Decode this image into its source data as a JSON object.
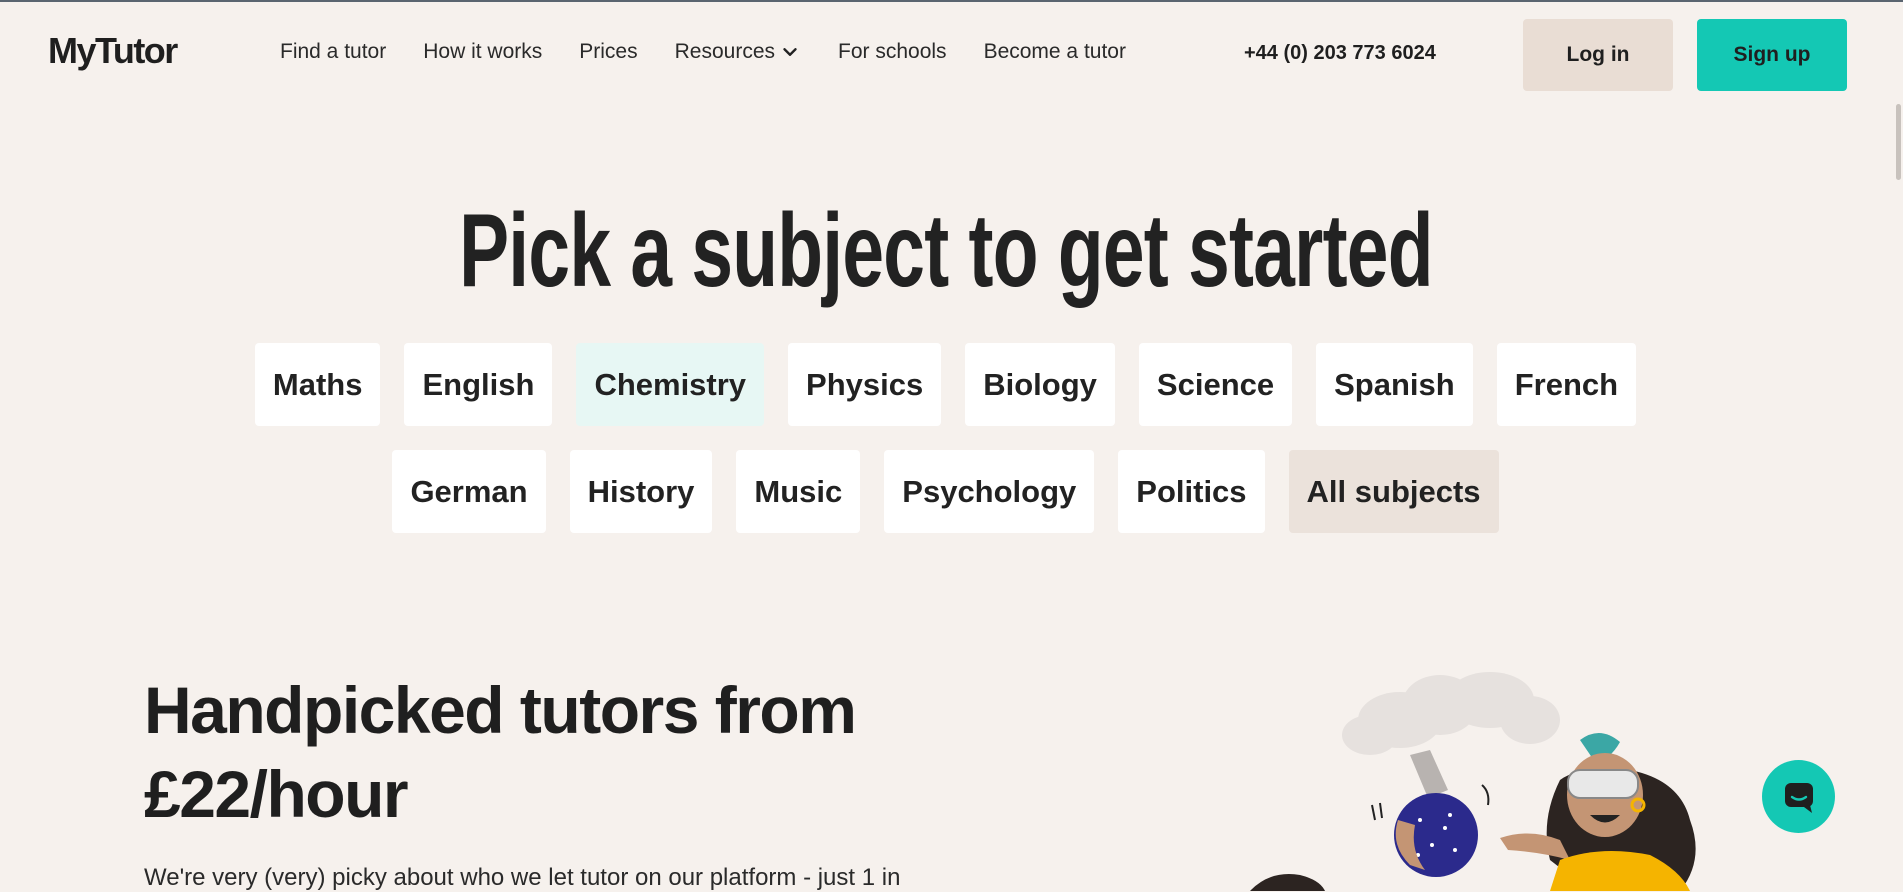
{
  "header": {
    "logo": "MyTutor",
    "nav": [
      {
        "label": "Find a tutor"
      },
      {
        "label": "How it works"
      },
      {
        "label": "Prices"
      },
      {
        "label": "Resources"
      },
      {
        "label": "For schools"
      },
      {
        "label": "Become a tutor"
      }
    ],
    "phone": "+44 (0) 203 773 6024",
    "login_label": "Log in",
    "signup_label": "Sign up"
  },
  "hero": {
    "title": "Pick a subject to get started",
    "subjects_row1": [
      "Maths",
      "English",
      "Chemistry",
      "Physics",
      "Biology",
      "Science",
      "Spanish",
      "French"
    ],
    "subjects_row2": [
      "German",
      "History",
      "Music",
      "Psychology",
      "Politics",
      "All subjects"
    ],
    "highlighted_subject": "Chemistry"
  },
  "handpicked": {
    "title_line1": "Handpicked tutors from",
    "title_line2": "£22/hour",
    "text": "We're very (very) picky about who we let tutor on our platform - just 1 in"
  },
  "colors": {
    "background": "#f6f1ed",
    "accent": "#14c8b4",
    "login_bg": "#e9ddd4",
    "chip_highlight": "#e7f7f4"
  },
  "icons": {
    "resources_dropdown": "chevron-down-icon",
    "chat": "chat-icon"
  }
}
